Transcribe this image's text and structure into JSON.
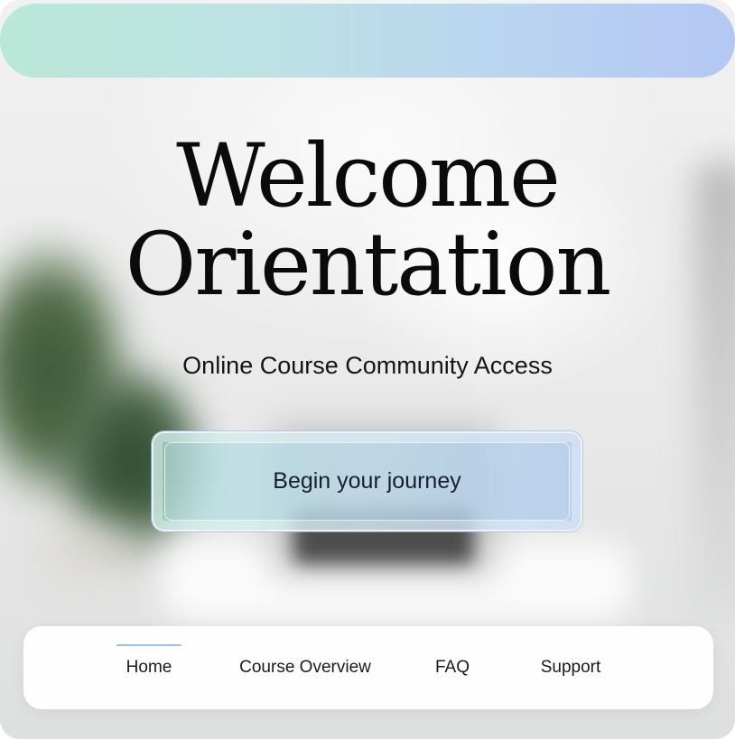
{
  "hero": {
    "title_line1": "Welcome",
    "title_line2": "Orientation",
    "subtitle": "Online Course Community Access"
  },
  "cta": {
    "label": "Begin your journey"
  },
  "nav": {
    "items": [
      {
        "label": "Home",
        "active": true
      },
      {
        "label": "Course Overview",
        "active": false
      },
      {
        "label": "FAQ",
        "active": false
      },
      {
        "label": "Support",
        "active": false
      }
    ]
  },
  "colors": {
    "banner_start": "#b9e8d7",
    "banner_end": "#b3c7f5",
    "nav_indicator": "#9dc0e6",
    "text": "#0b0b0b"
  }
}
